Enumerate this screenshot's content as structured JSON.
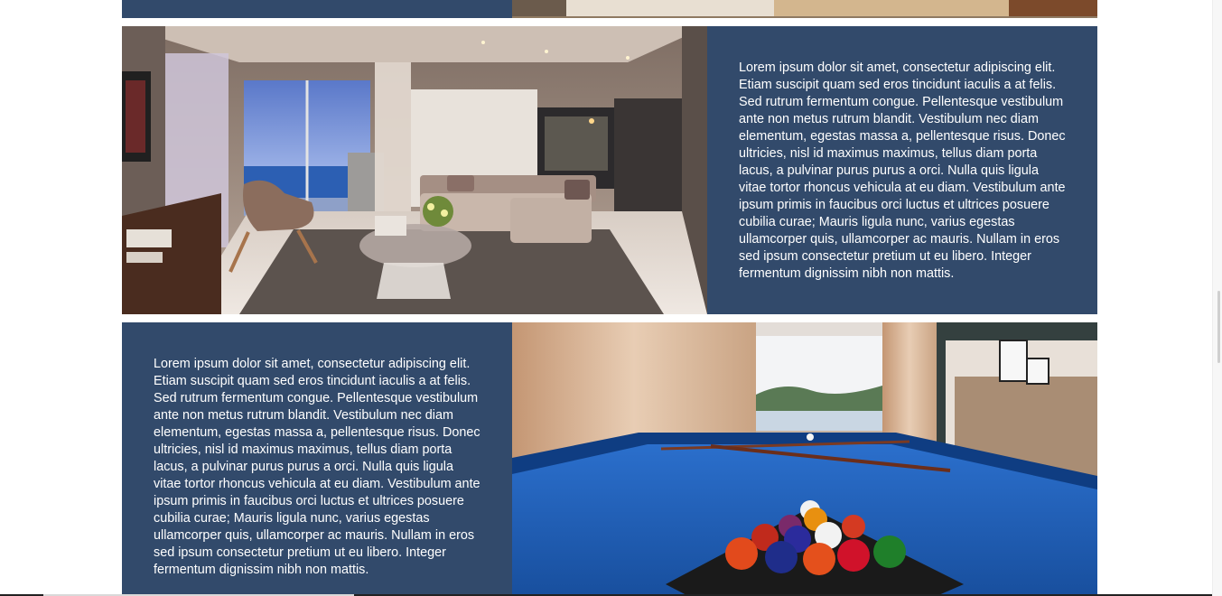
{
  "sections": [
    {
      "id": "living-room",
      "image_alt": "Living room with ocean view",
      "paragraph": "Lorem ipsum dolor sit amet, consectetur adipiscing elit. Etiam suscipit quam sed eros tincidunt iaculis a at felis. Sed rutrum fermentum congue. Pellentesque vestibulum ante non metus rutrum blandit. Vestibulum nec diam elementum, egestas massa a, pellentesque risus. Donec ultricies, nisl id maximus maximus, tellus diam porta lacus, a pulvinar purus purus a orci. Nulla quis ligula vitae tortor rhoncus vehicula at eu diam. Vestibulum ante ipsum primis in faucibus orci luctus et ultrices posuere cubilia curae; Mauris ligula nunc, varius egestas ullamcorper quis, ullamcorper ac mauris. Nullam in eros sed ipsum consectetur pretium ut eu libero. Integer fermentum dignissim nibh non mattis."
    },
    {
      "id": "game-room",
      "image_alt": "Game room with pool table",
      "paragraph": "Lorem ipsum dolor sit amet, consectetur adipiscing elit. Etiam suscipit quam sed eros tincidunt iaculis a at felis. Sed rutrum fermentum congue. Pellentesque vestibulum ante non metus rutrum blandit. Vestibulum nec diam elementum, egestas massa a, pellentesque risus. Donec ultricies, nisl id maximus maximus, tellus diam porta lacus, a pulvinar purus purus a orci. Nulla quis ligula vitae tortor rhoncus vehicula at eu diam. Vestibulum ante ipsum primis in faucibus orci luctus et ultrices posuere cubilia curae; Mauris ligula nunc, varius egestas ullamcorper quis, ullamcorper ac mauris. Nullam in eros sed ipsum consectetur pretium ut eu libero. Integer fermentum dignissim nibh non mattis."
    }
  ],
  "colors": {
    "panel_bg": "#324a6b",
    "panel_text": "#ffffff",
    "page_bg": "#ffffff",
    "pool_felt": "#1f5fb8"
  }
}
